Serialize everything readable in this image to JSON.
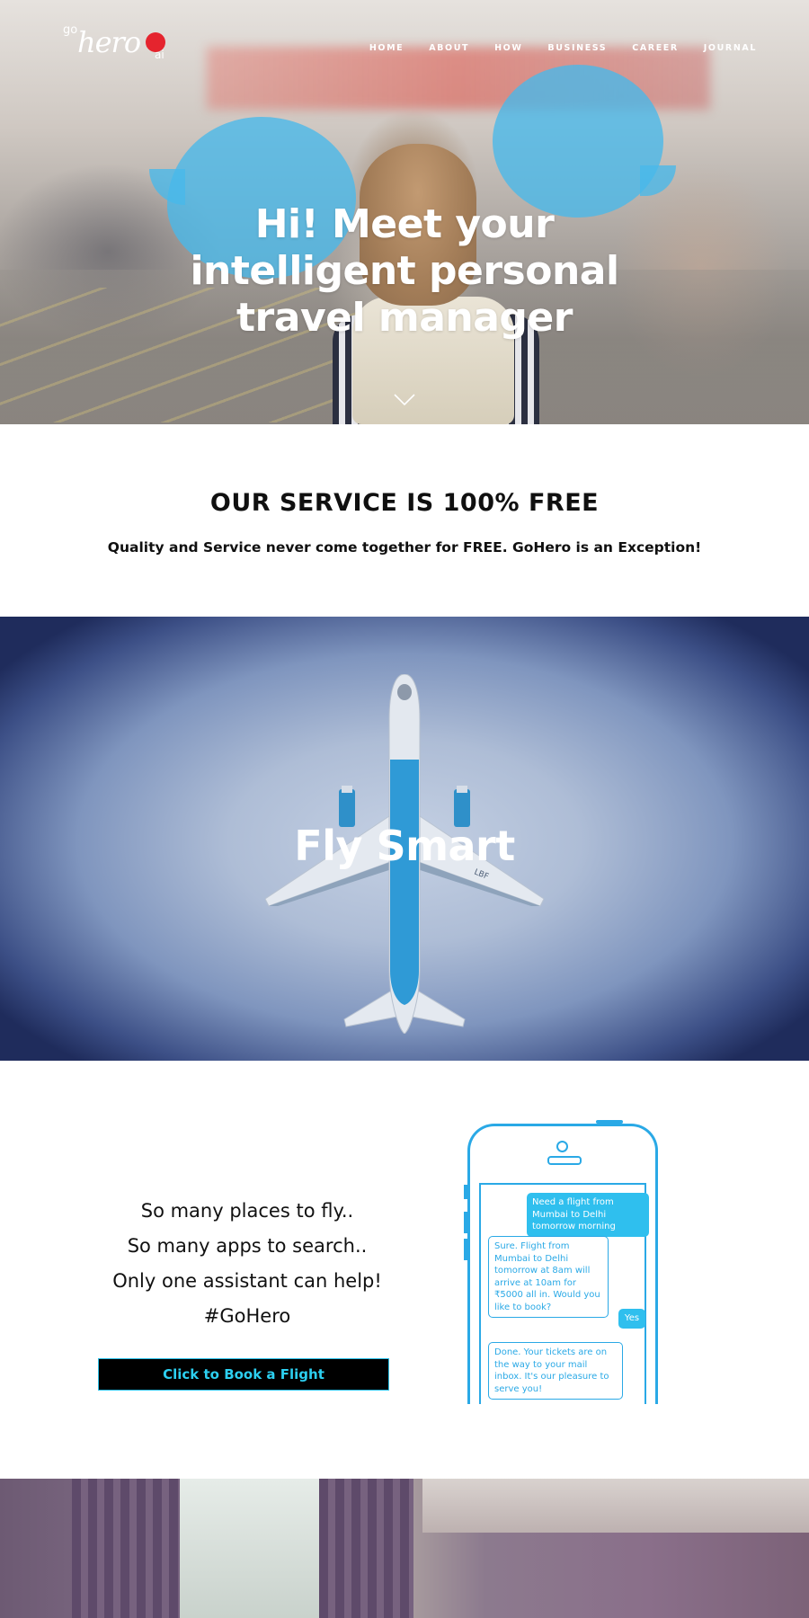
{
  "brand": {
    "go": "go",
    "hero": "hero",
    "ai": "ai"
  },
  "nav": [
    "HOME",
    "ABOUT",
    "HOW",
    "BUSINESS",
    "CAREER",
    "JOURNAL"
  ],
  "hero": {
    "title_lines": [
      "Hi! Meet your",
      "intelligent personal",
      "travel manager"
    ]
  },
  "free": {
    "title": "OUR SERVICE IS 100% FREE",
    "subtitle": "Quality and Service never come together for FREE. GoHero is an Exception!"
  },
  "fly": {
    "title": "Fly Smart"
  },
  "pitch": {
    "lines": [
      "So many places to fly..",
      "So many apps to search..",
      "Only one assistant can help!",
      "#GoHero"
    ],
    "button": "Click to Book a Flight"
  },
  "chat": [
    {
      "from": "user",
      "text": "Need a flight from Mumbai to Delhi tomorrow morning"
    },
    {
      "from": "bot",
      "text": "Sure. Flight from Mumbai to Delhi tomorrow at 8am will arrive at 10am for ₹5000 all in. Would you like to book?"
    },
    {
      "from": "user",
      "text": "Yes"
    },
    {
      "from": "bot",
      "text": "Done. Your tickets are on the way to your mail inbox. It's our pleasure to serve you!"
    }
  ],
  "colors": {
    "accent": "#2cc0e8",
    "bubble": "#48b9eb",
    "logo_red": "#e5242e"
  }
}
